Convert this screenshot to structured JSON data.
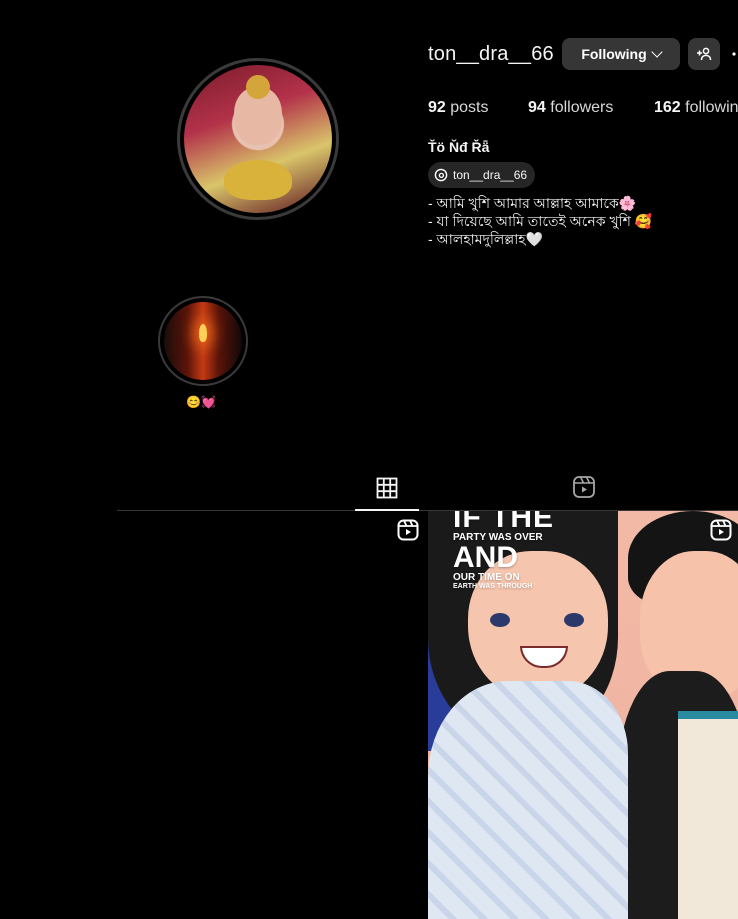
{
  "profile": {
    "username": "ton__dra__66",
    "follow_button_label": "Following",
    "full_name": "Ťö Ňđ Řǟ",
    "threads_handle": "ton__dra__66",
    "bio": "- আমি খুশি আমার আল্লাহ আমাকে🌸\n- যা দিয়েছে আমি তাতেই অনেক খুশি 🥰\n- আলহামদুলিল্লাহ🤍",
    "stats": {
      "posts_count": "92",
      "posts_label": "posts",
      "followers_count": "94",
      "followers_label": "followers",
      "following_count": "162",
      "following_label": "following"
    }
  },
  "highlights": [
    {
      "label": "😊💓"
    }
  ],
  "tabs": [
    {
      "name": "posts",
      "icon": "grid-icon",
      "active": true
    },
    {
      "name": "reels",
      "icon": "reels-icon",
      "active": false
    }
  ],
  "posts": [
    {
      "type": "reel",
      "overlay_text": []
    },
    {
      "type": "reel",
      "overlay_text": [
        "IF THE",
        "PARTY WAS OVER",
        "AND",
        "OUR TIME ON",
        "EARTH WAS THROUGH"
      ]
    }
  ],
  "colors": {
    "background": "#000000",
    "button_bg": "#363636",
    "text_primary": "#f5f5f5",
    "text_secondary": "#d8d8d8",
    "divider": "#363636"
  }
}
